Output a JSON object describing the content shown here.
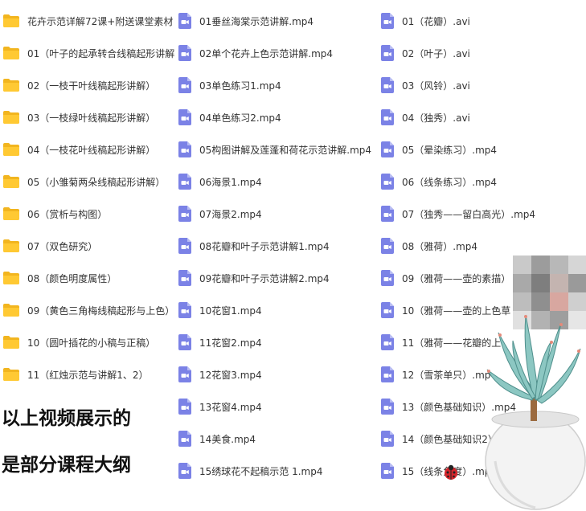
{
  "colors": {
    "folder": "#FFC933",
    "video_icon": "#7B82E6",
    "text": "#333333",
    "caption": "#111111"
  },
  "folders": [
    "花卉示范详解72课+附送课堂素材",
    "01（叶子的起承转合线稿起形讲解",
    "02（一枝干叶线稿起形讲解）",
    "03（一枝绿叶线稿起形讲解）",
    "04（一枝花叶线稿起形讲解）",
    "05（小雏菊两朵线稿起形讲解）",
    "06（赏析与构图）",
    "07（双色研究）",
    "08（颜色明度属性）",
    "09（黄色三角梅线稿起形与上色）",
    "10（圆叶插花的小稿与正稿）",
    "11（红烛示范与讲解1、2）"
  ],
  "videos_col2": [
    "01垂丝海棠示范讲解.mp4",
    "02单个花卉上色示范讲解.mp4",
    "03单色练习1.mp4",
    "04单色练习2.mp4",
    "05构图讲解及莲蓬和荷花示范讲解.mp4",
    "06海景1.mp4",
    "07海景2.mp4",
    "08花瓣和叶子示范讲解1.mp4",
    "09花瓣和叶子示范讲解2.mp4",
    "10花窗1.mp4",
    "11花窗2.mp4",
    "12花窗3.mp4",
    "13花窗4.mp4",
    "14美食.mp4",
    "15绣球花不起稿示范 1.mp4"
  ],
  "videos_col3": [
    "01（花瓣）.avi",
    "02（叶子）.avi",
    "03（风铃）.avi",
    "04（独秀）.avi",
    "05（晕染练习）.mp4",
    "06（线条练习）.mp4",
    "07（独秀——留白高光）.mp4",
    "08（雅荷）.mp4",
    "09（雅荷——壶的素描）",
    "10（雅荷——壶的上色草",
    "11（雅荷——花瓣的上",
    "12（雪茶单只）.mp",
    "13（颜色基础知识）.mp4",
    "14（颜色基础知识2）",
    "15（线条角度）.mp4"
  ],
  "caption": {
    "line1": "以上视频展示的",
    "line2": "是部分课程大纲"
  }
}
